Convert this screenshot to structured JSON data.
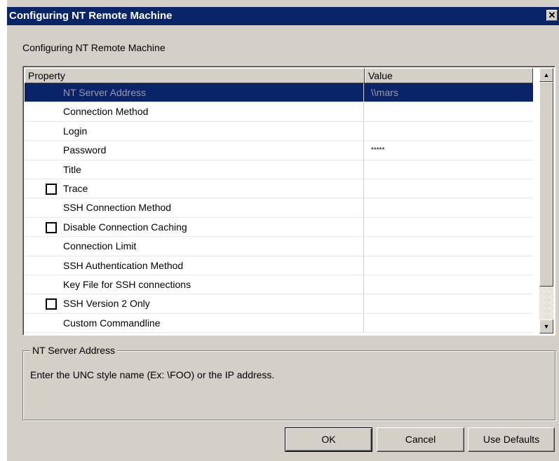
{
  "window": {
    "title": "Configuring NT Remote Machine",
    "close_glyph": "✕"
  },
  "subtitle": "Configuring NT Remote Machine",
  "grid": {
    "columns": [
      "Property",
      "Value"
    ],
    "rows": [
      {
        "name": "NT Server Address",
        "value": "\\\\mars",
        "selected": true,
        "checkbox": false
      },
      {
        "name": "Connection Method",
        "value": "",
        "checkbox": false
      },
      {
        "name": "Login",
        "value": "",
        "checkbox": false
      },
      {
        "name": "Password",
        "value": "*****",
        "checkbox": false
      },
      {
        "name": "Title",
        "value": "",
        "checkbox": false
      },
      {
        "name": "Trace",
        "value": "",
        "checkbox": true,
        "checked": false
      },
      {
        "name": "SSH Connection Method",
        "value": "",
        "checkbox": false
      },
      {
        "name": "Disable Connection Caching",
        "value": "",
        "checkbox": true,
        "checked": false
      },
      {
        "name": "Connection Limit",
        "value": "",
        "checkbox": false
      },
      {
        "name": "SSH Authentication Method",
        "value": "",
        "checkbox": false
      },
      {
        "name": "Key File for SSH connections",
        "value": "",
        "checkbox": false
      },
      {
        "name": "SSH Version 2 Only",
        "value": "",
        "checkbox": true,
        "checked": false
      },
      {
        "name": "Custom Commandline",
        "value": "",
        "checkbox": false
      }
    ]
  },
  "description": {
    "label": "NT Server Address",
    "text": "Enter the UNC style name (Ex: \\FOO) or the IP address."
  },
  "buttons": {
    "ok": "OK",
    "cancel": "Cancel",
    "defaults": "Use Defaults"
  },
  "scrollbar": {
    "up_glyph": "▲",
    "down_glyph": "▼"
  },
  "colors": {
    "titlebar": "#0a246a",
    "dialog_bg": "#d4d0c8",
    "selection": "#0a246a"
  }
}
